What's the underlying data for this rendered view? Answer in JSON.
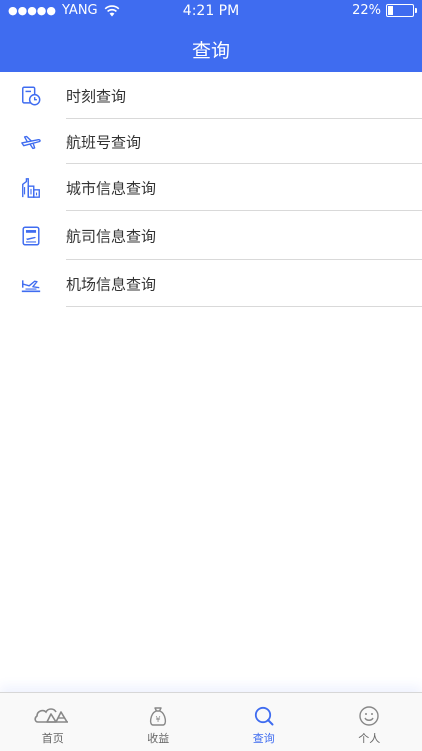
{
  "status": {
    "carrier": "YANG",
    "time": "4:21 PM",
    "battery": "22%",
    "battery_level": 0.22
  },
  "header": {
    "title": "查询"
  },
  "menu": {
    "items": [
      {
        "label": "时刻查询",
        "icon": "schedule-clock-icon"
      },
      {
        "label": "航班号查询",
        "icon": "airplane-icon"
      },
      {
        "label": "城市信息查询",
        "icon": "city-buildings-icon"
      },
      {
        "label": "航司信息查询",
        "icon": "airline-card-icon"
      },
      {
        "label": "机场信息查询",
        "icon": "airport-icon"
      }
    ]
  },
  "tabbar": {
    "tabs": [
      {
        "label": "首页",
        "icon": "home-logo-icon",
        "active": false
      },
      {
        "label": "收益",
        "icon": "money-bag-icon",
        "active": false
      },
      {
        "label": "查询",
        "icon": "search-icon",
        "active": true
      },
      {
        "label": "个人",
        "icon": "smiley-face-icon",
        "active": false
      }
    ]
  },
  "colors": {
    "primary": "#3f6cf0",
    "text": "#333333",
    "divider": "#d9d9d9",
    "tab_inactive": "#666666"
  }
}
